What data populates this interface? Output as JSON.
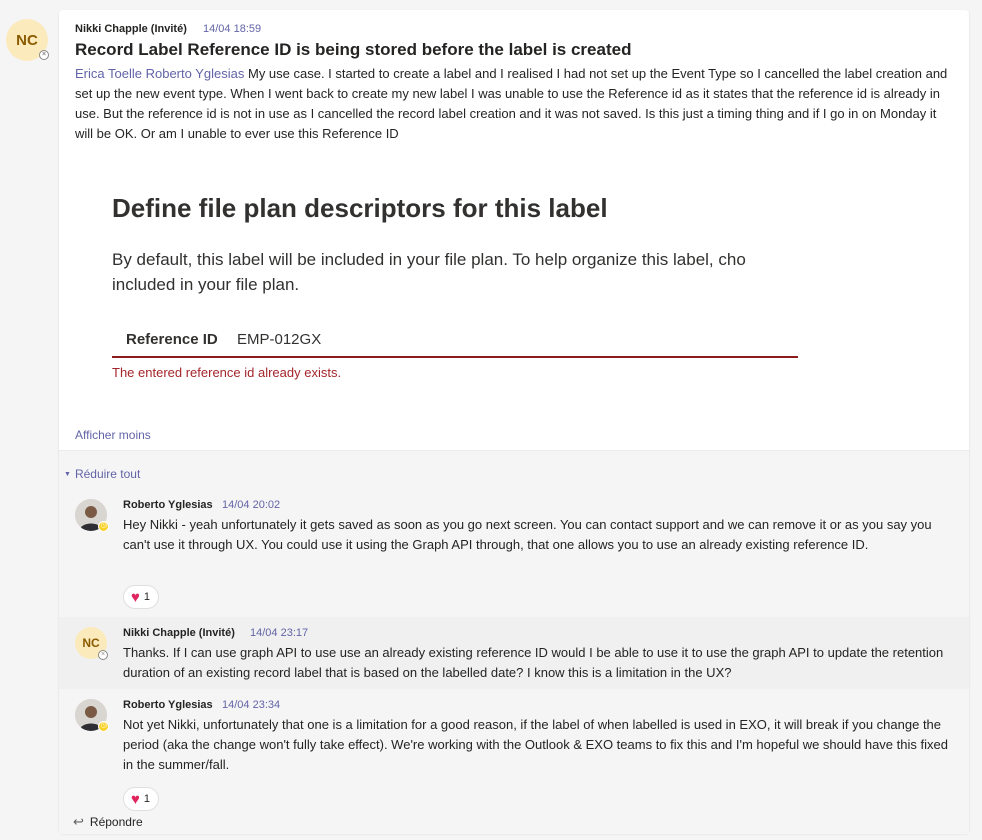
{
  "post": {
    "avatar_initials": "NC",
    "author": "Nikki Chapple (Invité)",
    "time": "14/04 18:59",
    "title": "Record Label Reference ID is being stored before the label is created",
    "mention1": "Erica Toelle",
    "mention2": "Roberto Yglesias",
    "body": "My use case. I started to create a label and I realised I had not set up the Event Type so I cancelled the label creation and set up the new event type. When I went back to create my new label I was unable to use the Reference id as it states that the reference id is already in use. But the reference id is not in use as I cancelled the record label creation and it was not saved. Is this just a timing thing and if I go in on Monday it will be OK. Or am I unable to ever use this Reference ID",
    "embed": {
      "title": "Define file plan descriptors for this label",
      "desc": "By default, this label will be included in your file plan. To help organize this label, cho included in your file plan.",
      "ref_label": "Reference ID",
      "ref_value": "EMP-012GX",
      "error": "The entered reference id already exists."
    },
    "show_less": "Afficher moins"
  },
  "thread": {
    "collapse_label": "Réduire tout",
    "replies": [
      {
        "author": "Roberto Yglesias",
        "time": "14/04 20:02",
        "body": "Hey Nikki - yeah unfortunately it gets saved as soon as you go next screen. You can contact support and we can remove it or as you say you can't use it through UX. You could use it using the Graph API through, that one allows you to use an already existing reference ID.",
        "reaction_count": "1"
      },
      {
        "author": "Nikki Chapple (Invité)",
        "initials": "NC",
        "time": "14/04 23:17",
        "body": "Thanks. If I can use graph API to use use an already existing reference ID would I be able to use it to use the graph API to update the retention duration of an existing record label that is based on the labelled date? I know this is a limitation in the UX?"
      },
      {
        "author": "Roberto Yglesias",
        "time": "14/04 23:34",
        "body": "Not yet Nikki, unfortunately that one is a limitation for a good reason, if the label of when labelled is used in EXO, it will break if you change the period (aka the change won't fully take effect). We're working with the Outlook & EXO teams to fix this and I'm hopeful we should have this fixed in the summer/fall.",
        "reaction_count": "1"
      }
    ],
    "reply_label": "Répondre"
  }
}
